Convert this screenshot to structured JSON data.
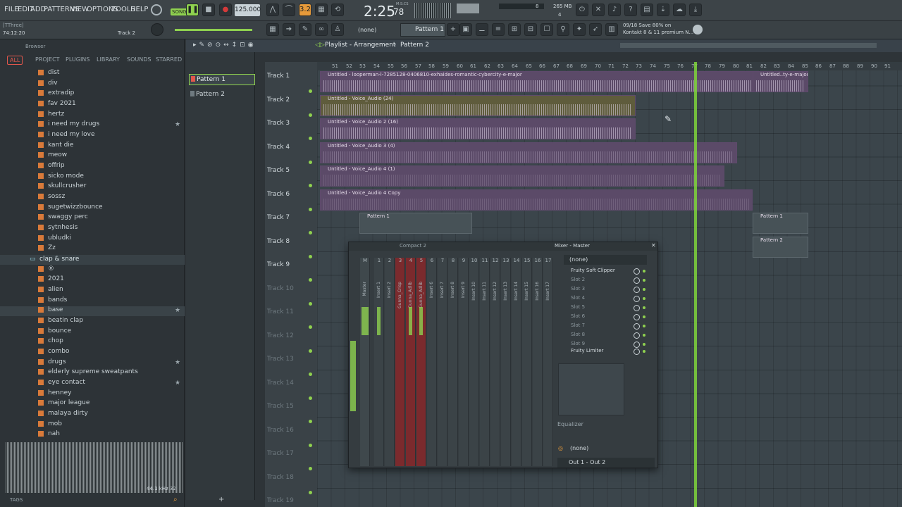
{
  "menu": [
    "FILE",
    "EDIT",
    "ADD",
    "PATTERNS",
    "VIEW",
    "OPTIONS",
    "TOOLS",
    "HELP"
  ],
  "transport": {
    "song_label": "SONG",
    "tempo": "125.000",
    "time": "2:25",
    "time_small": "78",
    "time_unit": "M:S:CS",
    "cpu": "8",
    "cpu2": "4",
    "memory": "265 MB"
  },
  "hint": {
    "line1": "[TThree]",
    "line2": "74:12:20",
    "track": "Track 2"
  },
  "snap": "(none)",
  "pattern_selector": "Pattern 1",
  "news": {
    "line1": "09/18 Save 80% on",
    "line2": "Kontakt 8 & 11 premium N..."
  },
  "browser": {
    "title": "Browser",
    "tabs": [
      "ALL",
      "PROJECT",
      "PLUGINS",
      "LIBRARY",
      "SOUNDS",
      "STARRED"
    ],
    "items": [
      "dist",
      "div",
      "extradip",
      "fav 2021",
      "hertz",
      "i need my drugs",
      "i need my love",
      "kant die",
      "meow",
      "offrip",
      "sicko mode",
      "skullcrusher",
      "sossz",
      "sugetwizzbounce",
      "swaggy perc",
      "sytnhesis",
      "ubludki",
      "Zz"
    ],
    "folder": "clap & snare",
    "items2": [
      "®",
      "2021",
      "alien",
      "bands",
      "base",
      "beatin clap",
      "bounce",
      "chop",
      "combo",
      "drugs",
      "elderly supreme sweatpants",
      "eye contact",
      "henney",
      "major league",
      "malaya dirty",
      "mob",
      "nah"
    ],
    "sample_info": "44.1 kHz 32",
    "tags_label": "TAGS"
  },
  "patterns": [
    "Pattern 1",
    "Pattern 2"
  ],
  "playlist": {
    "title": "Playlist - Arrangement",
    "sep": "›",
    "pattern": "Pattern 2"
  },
  "ruler": [
    "51",
    "52",
    "53",
    "54",
    "55",
    "56",
    "57",
    "58",
    "59",
    "60",
    "61",
    "62",
    "63",
    "64",
    "65",
    "66",
    "67",
    "68",
    "69",
    "70",
    "71",
    "72",
    "73",
    "74",
    "75",
    "76",
    "77",
    "78",
    "79",
    "80",
    "81",
    "82",
    "83",
    "84",
    "85",
    "86",
    "87",
    "88",
    "89",
    "90",
    "91"
  ],
  "tracks": [
    "Track 1",
    "Track 2",
    "Track 3",
    "Track 4",
    "Track 5",
    "Track 6",
    "Track 7",
    "Track 8",
    "Track 9",
    "Track 10",
    "Track 11",
    "Track 12",
    "Track 13",
    "Track 14",
    "Track 15",
    "Track 16",
    "Track 17",
    "Track 18",
    "Track 19"
  ],
  "clips": [
    "Untitled - looperman-l-7285128-0406810-exhaides-romantic-cybercity-e-major",
    "Untitled..ty-e-major",
    "Untitled - Voice_Audio (24)",
    "Untitled - Voice_Audio 2 (16)",
    "Untitled - Voice_Audio 3 (4)",
    "Untitled - Voice_Audio 4 (1)",
    "Untitled - Voice_Audio 4 Copy",
    "Pattern 1",
    "Pattern 1",
    "Pattern 2"
  ],
  "mixer": {
    "compact_label": "Compact 2",
    "title": "Mixer - Master",
    "strips": [
      "C",
      "M",
      "1",
      "2",
      "3",
      "4",
      "5",
      "6",
      "7",
      "8",
      "9",
      "10",
      "11",
      "12",
      "13",
      "14",
      "15",
      "16",
      "17"
    ],
    "names": [
      "Master",
      "Insert 1",
      "Insert 2",
      "Gunna_Crisp",
      "Gunna_Adlib",
      "Gunna_Adlib",
      "Insert 6",
      "Insert 7",
      "Insert 8",
      "Insert 9",
      "Insert 10",
      "Insert 11",
      "Insert 12",
      "Insert 13",
      "Insert 14",
      "Insert 15",
      "Insert 16",
      "Insert 17"
    ],
    "input": "(none)",
    "slots": [
      "Fruity Soft Clipper",
      "Slot 2",
      "Slot 3",
      "Slot 4",
      "Slot 5",
      "Slot 6",
      "Slot 7",
      "Slot 8",
      "Slot 9",
      "Fruity Limiter"
    ],
    "eq_label": "Equalizer",
    "send": "(none)",
    "output": "Out 1 - Out 2"
  },
  "colors": {
    "accent_green": "#8fd14f",
    "clip_purple": "#6b5479",
    "clip_olive": "#6c6a3f",
    "record_red": "#d33a3a",
    "tempo_bg": "#c8d2d7"
  }
}
